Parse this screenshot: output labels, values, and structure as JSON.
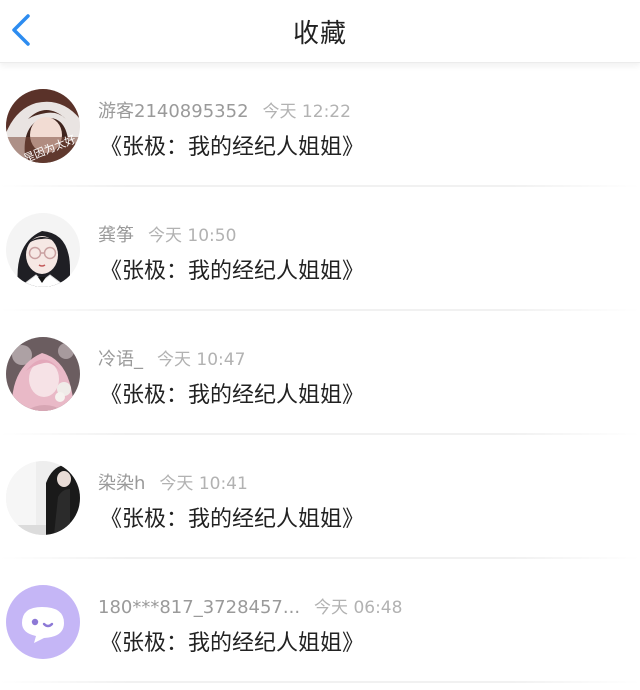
{
  "header": {
    "title": "收藏",
    "back_icon": "chevron-left-icon",
    "accent_color": "#2d8cf0"
  },
  "favorites": [
    {
      "username": "游客2140895352",
      "time": "今天 12:22",
      "book": "《张极：我的经纪人姐姐》",
      "avatar": "anime-girl-avatar-with-text"
    },
    {
      "username": "龚筝",
      "time": "今天 10:50",
      "book": "《张极：我的经纪人姐姐》",
      "avatar": "anime-girl-glasses-avatar"
    },
    {
      "username": "冷语_",
      "time": "今天 10:47",
      "book": "《张极：我的经纪人姐姐》",
      "avatar": "pink-hair-girl-avatar"
    },
    {
      "username": "染染h",
      "time": "今天 10:41",
      "book": "《张极：我的经纪人姐姐》",
      "avatar": "dark-figure-avatar"
    },
    {
      "username": "180***817_3728457...",
      "time": "今天 06:48",
      "book": "《张极：我的经纪人姐姐》",
      "avatar": "default-chat-bubble-avatar"
    }
  ]
}
